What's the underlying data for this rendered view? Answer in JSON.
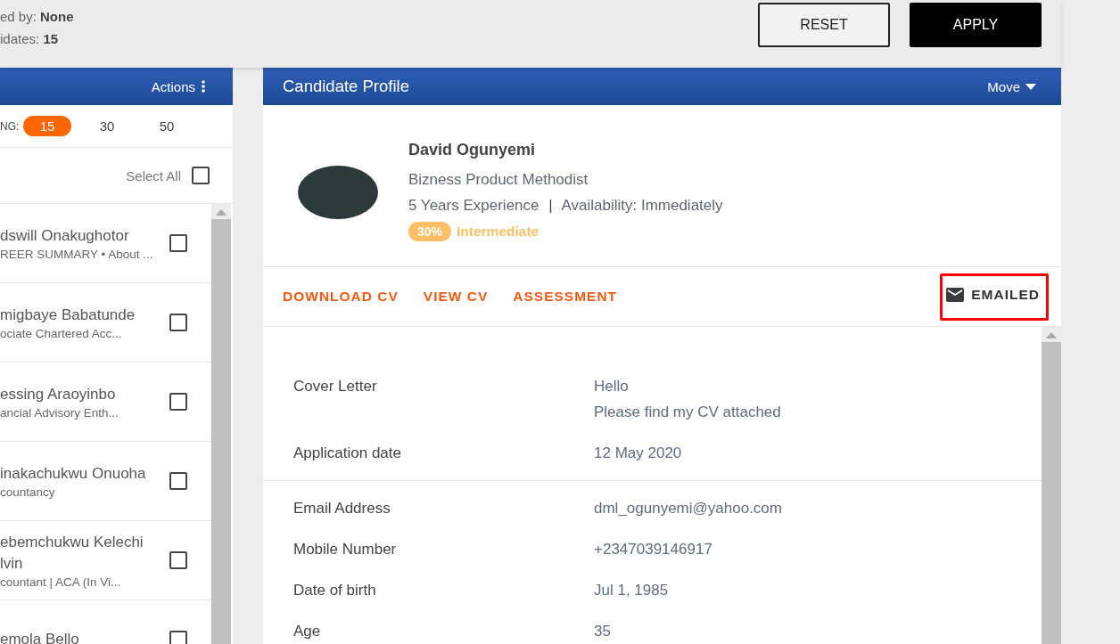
{
  "filter_summary": [
    {
      "label": "ed by:",
      "value": "None"
    },
    {
      "label": "idates:",
      "value": "15"
    }
  ],
  "filter_buttons": [
    {
      "label": "RESET",
      "kind": "outline"
    },
    {
      "label": "APPLY",
      "kind": "solid"
    }
  ],
  "list_panel": {
    "actions_label": "Actions",
    "page_size_label": "NG:",
    "page_sizes": [
      {
        "label": "15",
        "selected": true
      },
      {
        "label": "30",
        "selected": false
      },
      {
        "label": "50",
        "selected": false
      }
    ],
    "select_all": {
      "label": "Select All",
      "checked": false
    },
    "candidates": [
      {
        "name": "dswill Onakughotor",
        "summary": "REER SUMMARY • About ...",
        "checked": false
      },
      {
        "name": "migbaye Babatunde",
        "summary": "ociate Chartered Acc...",
        "checked": false
      },
      {
        "name": "essing Araoyinbo",
        "summary": "ancial Advisory Enth...",
        "checked": false
      },
      {
        "name": "inakachukwu Onuoha",
        "summary": "countancy",
        "checked": false
      },
      {
        "name": "ebemchukwu Kelechi lvin",
        "summary": "countant | ACA (In Vi...",
        "checked": false
      },
      {
        "name": "emola Bello",
        "checked": false
      }
    ]
  },
  "profile_panel": {
    "title": "Candidate Profile",
    "move_label": "Move",
    "name": "David Ogunyemi",
    "job_title": "Bizness Product Methodist",
    "experience": "5 Years Experience",
    "separator": "|",
    "availability": "Availability: Immediately",
    "score": "30%",
    "score_level": "Intermediate",
    "actions": [
      {
        "label": "DOWNLOAD CV",
        "kind": "link",
        "highlighted": false
      },
      {
        "label": "VIEW CV",
        "kind": "link",
        "highlighted": false
      },
      {
        "label": "ASSESSMENT",
        "kind": "link",
        "highlighted": false
      },
      {
        "label": "EMAILED",
        "kind": "status",
        "highlighted": true
      }
    ],
    "detail_sections": [
      [
        {
          "label": "Cover Letter",
          "values": [
            "Hello",
            "Please find my CV attached"
          ]
        },
        {
          "label": "Application date",
          "values": [
            "12 May 2020"
          ]
        }
      ],
      [
        {
          "label": "Email Address",
          "values": [
            "dml_ogunyemi@yahoo.com"
          ]
        },
        {
          "label": "Mobile Number",
          "values": [
            "+2347039146917"
          ]
        },
        {
          "label": "Date of birth",
          "values": [
            "Jul 1, 1985"
          ]
        },
        {
          "label": "Age",
          "values": [
            "35"
          ]
        }
      ]
    ]
  }
}
